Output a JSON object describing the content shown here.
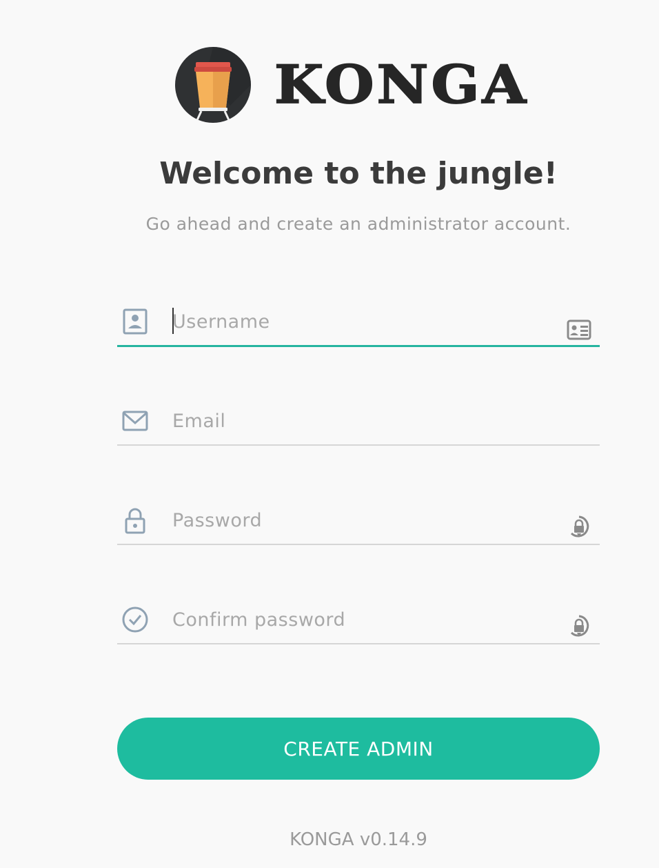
{
  "brand": {
    "name": "KONGA",
    "accent_color": "#1ebc9f",
    "logo_icon": "conga-drum-icon"
  },
  "welcome": {
    "title": "Welcome to the jungle!",
    "subtitle": "Go ahead and create an administrator account."
  },
  "form": {
    "username": {
      "placeholder": "Username",
      "value": "",
      "lead_icon": "user-card-icon",
      "trail_icon": "id-card-icon"
    },
    "email": {
      "placeholder": "Email",
      "value": "",
      "lead_icon": "envelope-icon"
    },
    "password": {
      "placeholder": "Password",
      "value": "",
      "lead_icon": "lock-icon",
      "trail_icon": "password-manager-icon"
    },
    "confirm_password": {
      "placeholder": "Confirm password",
      "value": "",
      "lead_icon": "check-circle-icon",
      "trail_icon": "password-manager-icon"
    },
    "submit_label": "CREATE ADMIN"
  },
  "footer": {
    "version": "KONGA v0.14.9"
  }
}
